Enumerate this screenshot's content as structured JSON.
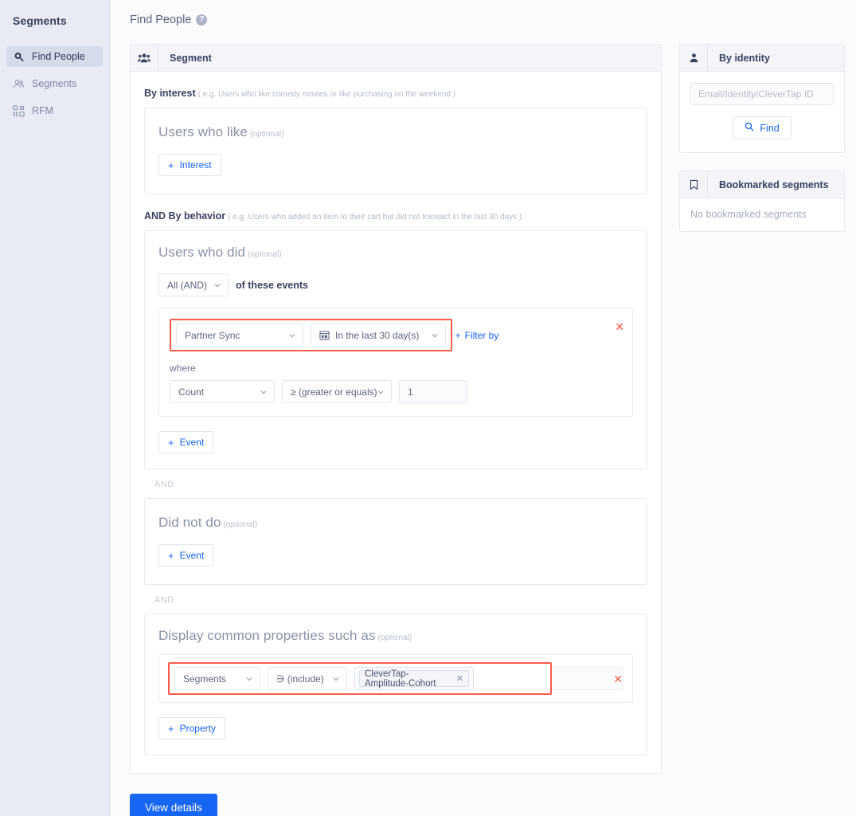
{
  "sidebar": {
    "title": "Segments",
    "items": [
      {
        "label": "Find People",
        "icon": "find-people-icon",
        "active": true
      },
      {
        "label": "Segments",
        "icon": "people-icon",
        "active": false
      },
      {
        "label": "RFM",
        "icon": "grid-icon",
        "active": false
      }
    ]
  },
  "header": {
    "title": "Find People",
    "help_icon": "question-mark-icon"
  },
  "segment_card": {
    "icon": "group-people-icon",
    "title": "Segment",
    "by_interest": {
      "label": "By interest",
      "hint": "( e.g. Users who like comedy movies or like purchasing on the weekend )",
      "block_title": "Users who like",
      "optional": "(optional)",
      "add_button": "Interest",
      "plus": "+"
    },
    "by_behavior": {
      "label": "AND By behavior",
      "hint": "( e.g. Users who added an item to their cart but did not transact in the last 30 days )",
      "block_title": "Users who did",
      "optional": "(optional)",
      "combinator_value": "All (AND)",
      "combinator_suffix": "of these events",
      "event": {
        "event_name": "Partner Sync",
        "date_range": "In the last 30 day(s)",
        "date_icon": "calendar-30-icon",
        "filter_by_link": "Filter by",
        "where_label": "where",
        "metric": "Count",
        "operator": "≥  (greater or equals)",
        "value": "1",
        "delete_icon": "✕"
      },
      "add_event_button": "Event",
      "plus": "+"
    },
    "and_separator": "AND",
    "did_not_do": {
      "block_title": "Did not do",
      "optional": "(optional)",
      "add_event_button": "Event",
      "plus": "+"
    },
    "common_properties": {
      "block_title": "Display common properties such as",
      "optional": "(optional)",
      "property_name": "Segments",
      "property_operator": "∋  (include)",
      "tag_value": "CleverTap-Amplitude-Cohort",
      "tag_remove_icon": "✕",
      "delete_icon": "✕",
      "add_property_button": "Property",
      "plus": "+"
    },
    "view_details_button": "View details"
  },
  "by_identity": {
    "icon": "person-icon",
    "title": "By identity",
    "input_placeholder": "Email/Identity/CleverTap ID",
    "input_value": "",
    "find_button": "Find",
    "find_icon": "search-icon"
  },
  "bookmarked": {
    "icon": "bookmark-icon",
    "title": "Bookmarked segments",
    "empty_text": "No bookmarked segments"
  },
  "colors": {
    "accent_blue": "#1765f3",
    "highlight_red": "#fb5a48",
    "sidebar_bg": "#e8ebf3",
    "page_bg": "#fafbfc"
  }
}
